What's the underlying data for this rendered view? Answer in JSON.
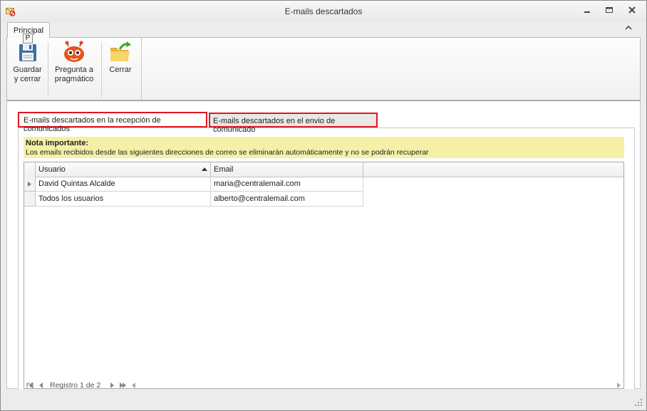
{
  "window": {
    "title": "E-mails descartados",
    "app_icon": "envelope-forbidden-icon",
    "controls": [
      "minimize-icon",
      "restore-icon",
      "close-icon"
    ]
  },
  "ribbon": {
    "tab": "Principal",
    "keytip": "P",
    "buttons": [
      {
        "label_line1": "Guardar",
        "label_line2": "y cerrar",
        "icon": "floppy-disk-icon"
      },
      {
        "label_line1": "Pregunta a",
        "label_line2": "pragmático",
        "icon": "robot-face-icon"
      },
      {
        "label_line1": "Cerrar",
        "label_line2": "",
        "icon": "folder-arrow-icon"
      }
    ]
  },
  "tabs": [
    {
      "label": "E-mails descartados en la recepción de comunicados",
      "active": true
    },
    {
      "label": "E-mails descartados en el envio de comunicado",
      "active": false
    }
  ],
  "note": {
    "title": "Nota importante:",
    "text": "Los emails recibidos desde las siguientes direcciones de correo se eliminarán automáticamente y no se podrán recuperar"
  },
  "grid": {
    "columns": [
      "Usuario",
      "Email"
    ],
    "sort_column": "Usuario",
    "sort_direction": "ascending",
    "rows": [
      {
        "usuario": "David Quintas Alcalde",
        "email": "maria@centralemail.com"
      },
      {
        "usuario": "Todos los usuarios",
        "email": "alberto@centralemail.com"
      }
    ],
    "navigator": "Registro 1 de 2"
  },
  "colors": {
    "highlight_border": "#e0171f",
    "note_background": "#f4f0a7"
  }
}
